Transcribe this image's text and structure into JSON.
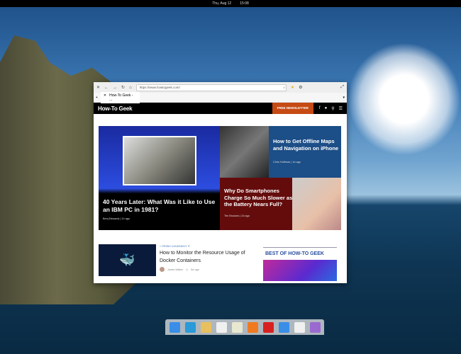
{
  "topbar": {
    "date": "Thu, Aug 12",
    "time": "15:08"
  },
  "browser": {
    "url": "https://www.howtogeek.com/",
    "tab_title": "How-To Geek - ..."
  },
  "site": {
    "logo": "How-To Geek",
    "newsletter": "FREE NEWSLETTER",
    "icons": [
      "facebook-icon",
      "twitter-icon",
      "search-icon",
      "menu-icon"
    ]
  },
  "hero": {
    "main": {
      "title": "40 Years Later: What Was it Like to Use an IBM PC in 1981?",
      "author": "Benj Edwards",
      "time": "1h ago"
    },
    "top_right": {
      "title": "How to Get Offline Maps and Navigation on iPhone",
      "author": "Chris Hoffman",
      "time": "1d ago"
    },
    "bottom_right": {
      "title": "Why Do Smartphones Charge So Much Slower as the Battery Nears Full?",
      "author": "Tim Brookes",
      "time": "2d ago"
    }
  },
  "article": {
    "source": "↪ FROM CLOUDSAVVY IT",
    "title": "How to Monitor the Resource Usage of Docker Containers",
    "author": "James Walker",
    "time": "5m ago"
  },
  "sidebar": {
    "heading": "BEST OF HOW-TO GEEK"
  },
  "dock": {
    "apps": [
      {
        "name": "multitasking",
        "color": "#3a8ee8"
      },
      {
        "name": "browser",
        "color": "#2a9ad8"
      },
      {
        "name": "mail",
        "color": "#e8c060"
      },
      {
        "name": "tasks",
        "color": "#f0f0f0"
      },
      {
        "name": "calendar",
        "color": "#e8e8d0"
      },
      {
        "name": "music",
        "color": "#f07a20"
      },
      {
        "name": "videos",
        "color": "#d82020"
      },
      {
        "name": "photos",
        "color": "#3a8ee8"
      },
      {
        "name": "settings",
        "color": "#f0f0f0"
      },
      {
        "name": "appcenter",
        "color": "#9a6ad0"
      }
    ]
  }
}
